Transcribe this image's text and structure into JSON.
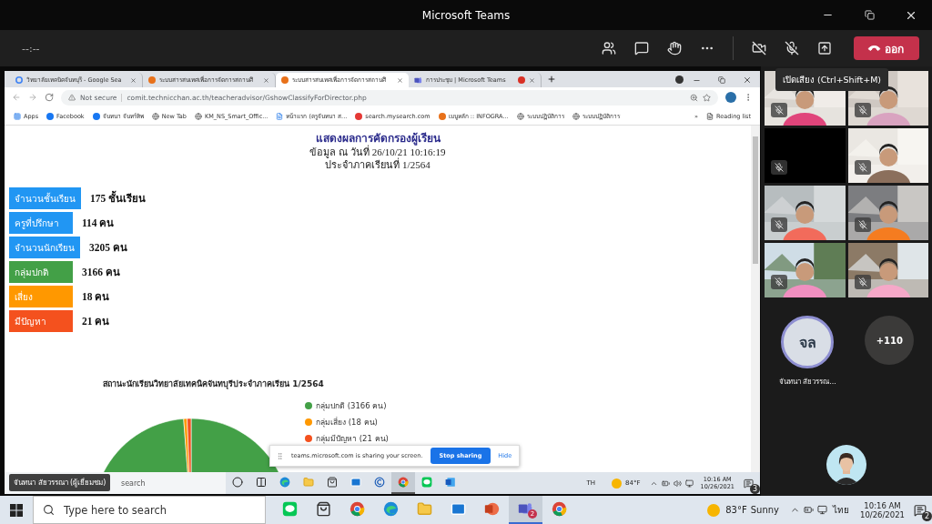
{
  "app_title": "Microsoft Teams",
  "meeting": {
    "timer": "--:--",
    "leave_label": "ออก",
    "camera_on": false,
    "mic_on": false
  },
  "browser": {
    "tabs": [
      {
        "title": "วิทยาลัยเทคนิคจันทบุรี - Google Sea",
        "kind": "google",
        "selected": false
      },
      {
        "title": "ระบบสารสนเทศเพื่อการจัดการสถานศึ",
        "kind": "orange",
        "selected": false
      },
      {
        "title": "ระบบสารสนเทศเพื่อการจัดการสถานศึ",
        "kind": "orange",
        "selected": true
      },
      {
        "title": "การประชุม | Microsoft Teams",
        "kind": "teams",
        "selected": false,
        "recording": true
      }
    ],
    "url_warning": "Not secure",
    "url": "comit.technicchan.ac.th/teacheradvisor/GshowClassifyForDirector.php",
    "bookmarks": [
      {
        "label": "Apps",
        "kind": "apps"
      },
      {
        "label": "Facebook",
        "kind": "facebook"
      },
      {
        "label": "จันทนา จันทร์ทิพ",
        "kind": "facebook"
      },
      {
        "label": "New Tab",
        "kind": "globe"
      },
      {
        "label": "KM_NS_Smart_Offic...",
        "kind": "globe"
      },
      {
        "label": "หน้าแรก (ครูจันทนา ส...",
        "kind": "page"
      },
      {
        "label": "search.mysearch.com",
        "kind": "search"
      },
      {
        "label": "เมนูหลัก :: INFOGRA...",
        "kind": "orange"
      },
      {
        "label": "ระบบปฏิบัติการ",
        "kind": "globe"
      },
      {
        "label": "ระบบปฏิบัติการ",
        "kind": "globe"
      }
    ],
    "overflow": "»",
    "reading_list": "Reading list"
  },
  "page": {
    "title": "แสดงผลการคัดกรองผู้เรียน",
    "updated": "ข้อมูล ณ วันที่ 26/10/21 10:16:19",
    "term": "ประจำภาคเรียนที่ 1/2564",
    "stats": [
      {
        "label": "จำนวนชั้นเรียน",
        "value": "175 ชั้นเรียน",
        "color": "#2196f3"
      },
      {
        "label": "ครูที่ปรึกษา",
        "value": "114 คน",
        "color": "#2196f3"
      },
      {
        "label": "จำนวนนักเรียน",
        "value": "3205 คน",
        "color": "#2196f3"
      },
      {
        "label": "กลุ่มปกติ",
        "value": "3166 คน",
        "color": "#43a047"
      },
      {
        "label": "เสี่ยง",
        "value": "18 คน",
        "color": "#ff9800"
      },
      {
        "label": "มีปัญหา",
        "value": "21 คน",
        "color": "#f4511e"
      }
    ],
    "chart_data": {
      "type": "pie",
      "title": "สถานะนักเรียนวิทยาลัยเทคนิคจันทบุรีประจำภาคเรียน 1/2564",
      "categories": [
        "กลุ่มปกติ (3166 คน)",
        "กลุ่มเสี่ยง (18 คน)",
        "กลุ่มมีปัญหา (21 คน)"
      ],
      "values": [
        3166,
        18,
        21
      ],
      "colors": [
        "#43a047",
        "#ff9800",
        "#f4511e"
      ]
    }
  },
  "sharing_bar": {
    "message": "teams.microsoft.com is sharing your screen.",
    "stop_label": "Stop sharing",
    "hide_label": "Hide"
  },
  "presenter_label": "จันทนา สัยวรรณา (ผู้เยี่ยมชม)",
  "inner_taskbar": {
    "search_text": "search",
    "apps": [
      {
        "kind": "cortana",
        "selected": false
      },
      {
        "kind": "taskview",
        "selected": false
      },
      {
        "kind": "edge",
        "selected": false
      },
      {
        "kind": "folder",
        "selected": false
      },
      {
        "kind": "store",
        "selected": false
      },
      {
        "kind": "mail",
        "selected": false
      },
      {
        "kind": "ccleaner",
        "selected": false
      },
      {
        "kind": "chrome",
        "selected": true
      },
      {
        "kind": "line",
        "selected": false
      },
      {
        "kind": "word",
        "selected": false
      }
    ],
    "lang": "TH",
    "temperature": "84°F",
    "time": "10:16 AM",
    "date": "10/26/2021",
    "notifications": "3"
  },
  "tooltip": "เปิดเสียง (Ctrl+Shift+M)",
  "participants": [
    {
      "kind": "video",
      "muted": true
    },
    {
      "kind": "video",
      "muted": true
    },
    {
      "kind": "off",
      "muted": true
    },
    {
      "kind": "video",
      "muted": true
    },
    {
      "kind": "video",
      "muted": true
    },
    {
      "kind": "video",
      "muted": true
    },
    {
      "kind": "video",
      "muted": true
    },
    {
      "kind": "video",
      "muted": true
    }
  ],
  "featured": {
    "initials": "จล",
    "name": "จันทนา สัยวรรณ...",
    "overflow_count": "+110"
  },
  "taskbar": {
    "search_placeholder": "Type here to search",
    "apps": [
      {
        "kind": "line",
        "selected": false
      },
      {
        "kind": "store",
        "selected": false
      },
      {
        "kind": "chrome",
        "selected": false
      },
      {
        "kind": "edge",
        "selected": false
      },
      {
        "kind": "folder",
        "selected": false
      },
      {
        "kind": "mail",
        "selected": false
      },
      {
        "kind": "powerpoint",
        "selected": false
      },
      {
        "kind": "teams",
        "selected": true,
        "badge": "2"
      },
      {
        "kind": "chrome",
        "selected": false
      }
    ],
    "temperature": "83°F",
    "weather": "Sunny",
    "lang": "ไทย",
    "time": "10:16 AM",
    "date": "10/26/2021",
    "notifications": "2"
  }
}
